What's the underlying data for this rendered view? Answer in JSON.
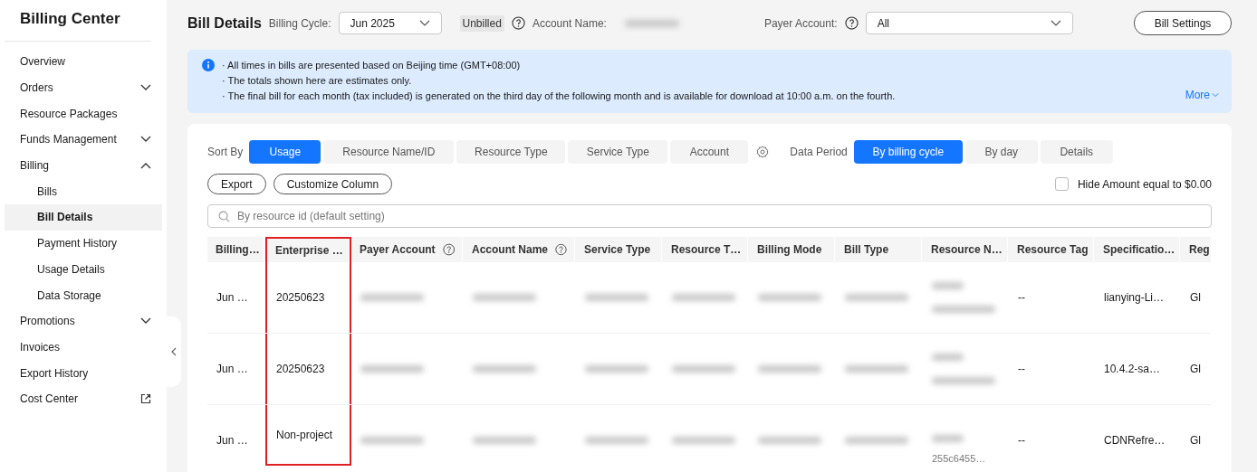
{
  "sidebar": {
    "title": "Billing Center",
    "items": [
      {
        "label": "Overview",
        "kind": "plain",
        "selected": false
      },
      {
        "label": "Orders",
        "kind": "group",
        "expanded": false,
        "selected": false
      },
      {
        "label": "Resource Packages",
        "kind": "plain",
        "selected": false
      },
      {
        "label": "Funds Management",
        "kind": "group",
        "expanded": false,
        "selected": false
      },
      {
        "label": "Billing",
        "kind": "group",
        "expanded": true,
        "selected": false,
        "children": [
          {
            "label": "Bills",
            "selected": false
          },
          {
            "label": "Bill Details",
            "selected": true
          },
          {
            "label": "Payment History",
            "selected": false
          },
          {
            "label": "Usage Details",
            "selected": false
          },
          {
            "label": "Data Storage",
            "selected": false
          }
        ]
      },
      {
        "label": "Promotions",
        "kind": "group",
        "expanded": false,
        "selected": false
      },
      {
        "label": "Invoices",
        "kind": "plain",
        "selected": false
      },
      {
        "label": "Export History",
        "kind": "plain",
        "selected": false
      },
      {
        "label": "Cost Center",
        "kind": "external",
        "selected": false
      }
    ]
  },
  "header": {
    "title": "Bill Details",
    "billing_cycle_label": "Billing Cycle:",
    "billing_cycle": "Jun 2025",
    "status_badge": "Unbilled",
    "account_name_label": "Account Name:",
    "payer_account_label": "Payer Account:",
    "payer_account": "All",
    "settings_button": "Bill Settings"
  },
  "notice": {
    "lines": [
      "· All times in bills are presented based on Beijing time (GMT+08:00)",
      "· The totals shown here are estimates only.",
      "· The final bill for each month (tax included) is generated on the third day of the following month and is available for download at 10:00 a.m. on the fourth."
    ],
    "more": "More"
  },
  "sort_by": {
    "label": "Sort By",
    "options": [
      {
        "label": "Usage",
        "selected": true
      },
      {
        "label": "Resource Name/ID",
        "selected": false
      },
      {
        "label": "Resource Type",
        "selected": false
      },
      {
        "label": "Service Type",
        "selected": false
      },
      {
        "label": "Account",
        "selected": false
      }
    ]
  },
  "data_period": {
    "label": "Data Period",
    "options": [
      {
        "label": "By billing cycle",
        "selected": true
      },
      {
        "label": "By day",
        "selected": false
      },
      {
        "label": "Details",
        "selected": false
      }
    ]
  },
  "actions": [
    "Export",
    "Customize Column"
  ],
  "hide_zero": {
    "label": "Hide Amount equal to $0.00",
    "checked": false
  },
  "search": {
    "placeholder": "By resource id (default setting)"
  },
  "table": {
    "columns": [
      {
        "label": "Billing…",
        "help": false,
        "highlighted": false
      },
      {
        "label": "Enterprise …",
        "help": false,
        "highlighted": true
      },
      {
        "label": "Payer Account",
        "help": true,
        "highlighted": false
      },
      {
        "label": "Account Name",
        "help": true,
        "highlighted": false
      },
      {
        "label": "Service Type",
        "help": false,
        "highlighted": false
      },
      {
        "label": "Resource T…",
        "help": false,
        "highlighted": false
      },
      {
        "label": "Billing Mode",
        "help": false,
        "highlighted": false
      },
      {
        "label": "Bill Type",
        "help": false,
        "highlighted": false
      },
      {
        "label": "Resource N…",
        "help": false,
        "highlighted": false
      },
      {
        "label": "Resource Tag",
        "help": false,
        "highlighted": false
      },
      {
        "label": "Specificatio…",
        "help": false,
        "highlighted": false
      },
      {
        "label": "Reg",
        "help": false,
        "highlighted": false
      }
    ],
    "rows": [
      [
        {
          "kind": "text",
          "text": "Jun …"
        },
        {
          "kind": "text",
          "text": "20250623"
        },
        {
          "kind": "blurred"
        },
        {
          "kind": "blurred"
        },
        {
          "kind": "blurred"
        },
        {
          "kind": "blurred"
        },
        {
          "kind": "blurred"
        },
        {
          "kind": "blurred"
        },
        {
          "kind": "blurred2"
        },
        {
          "kind": "text",
          "text": "--"
        },
        {
          "kind": "text",
          "text": "lianying-Li…"
        },
        {
          "kind": "text",
          "text": "Gl"
        }
      ],
      [
        {
          "kind": "text",
          "text": "Jun …"
        },
        {
          "kind": "text",
          "text": "20250623"
        },
        {
          "kind": "blurred"
        },
        {
          "kind": "blurred"
        },
        {
          "kind": "blurred"
        },
        {
          "kind": "blurred"
        },
        {
          "kind": "blurred"
        },
        {
          "kind": "blurred"
        },
        {
          "kind": "blurred2"
        },
        {
          "kind": "text",
          "text": "--"
        },
        {
          "kind": "text",
          "text": "10.4.2-sa…"
        },
        {
          "kind": "text",
          "text": "Gl"
        }
      ],
      [
        {
          "kind": "text",
          "text": "Jun …"
        },
        {
          "kind": "text",
          "text": "Non-project"
        },
        {
          "kind": "blurred"
        },
        {
          "kind": "blurred"
        },
        {
          "kind": "blurred"
        },
        {
          "kind": "blurred"
        },
        {
          "kind": "blurred"
        },
        {
          "kind": "blurred"
        },
        {
          "kind": "blurred2",
          "tail": "255c6455…"
        },
        {
          "kind": "text",
          "text": "--"
        },
        {
          "kind": "text",
          "text": "CDNRefre…"
        },
        {
          "kind": "text",
          "text": "Gl"
        }
      ]
    ]
  }
}
